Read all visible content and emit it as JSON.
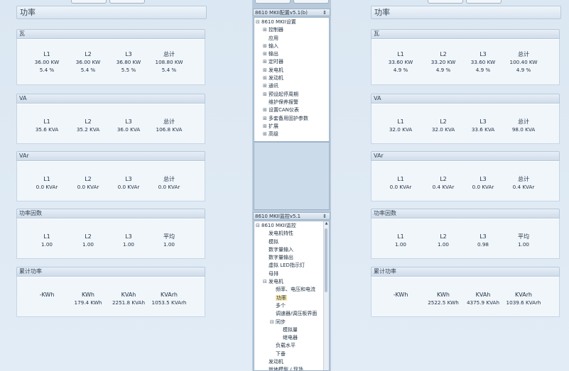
{
  "left": {
    "title": "功率",
    "groups": [
      {
        "name": "瓦",
        "cells": [
          {
            "label": "L1",
            "lines": [
              "36.00 KW",
              "5.4 %"
            ]
          },
          {
            "label": "L2",
            "lines": [
              "36.00 KW",
              "5.4 %"
            ]
          },
          {
            "label": "L3",
            "lines": [
              "36.80 KW",
              "5.5 %"
            ]
          },
          {
            "label": "总计",
            "lines": [
              "108.80 KW",
              "5.4 %"
            ]
          }
        ]
      },
      {
        "name": "VA",
        "cells": [
          {
            "label": "L1",
            "lines": [
              "35.6 KVA"
            ]
          },
          {
            "label": "L2",
            "lines": [
              "35.2 KVA"
            ]
          },
          {
            "label": "L3",
            "lines": [
              "36.0 KVA"
            ]
          },
          {
            "label": "总计",
            "lines": [
              "106.8 KVA"
            ]
          }
        ]
      },
      {
        "name": "VAr",
        "cells": [
          {
            "label": "L1",
            "lines": [
              "0.0 KVAr"
            ]
          },
          {
            "label": "L2",
            "lines": [
              "0.0 KVAr"
            ]
          },
          {
            "label": "L3",
            "lines": [
              "0.0 KVAr"
            ]
          },
          {
            "label": "总计",
            "lines": [
              "0.0 KVAr"
            ]
          }
        ]
      },
      {
        "name": "功率因数",
        "cells": [
          {
            "label": "L1",
            "lines": [
              "1.00"
            ]
          },
          {
            "label": "L2",
            "lines": [
              "1.00"
            ]
          },
          {
            "label": "L3",
            "lines": [
              "1.00"
            ]
          },
          {
            "label": "平均",
            "lines": [
              "1.00"
            ]
          }
        ]
      },
      {
        "name": "累计功率",
        "cells": [
          {
            "label": "-KWh",
            "lines": [
              ""
            ]
          },
          {
            "label": "KWh",
            "lines": [
              "179.4 KWh"
            ]
          },
          {
            "label": "KVAh",
            "lines": [
              "2251.8 KVAh"
            ]
          },
          {
            "label": "KVArh",
            "lines": [
              "1053.5 KVArh"
            ]
          }
        ]
      }
    ]
  },
  "right": {
    "title": "功率",
    "groups": [
      {
        "name": "瓦",
        "cells": [
          {
            "label": "L1",
            "lines": [
              "33.60 KW",
              "4.9 %"
            ]
          },
          {
            "label": "L2",
            "lines": [
              "33.20 KW",
              "4.9 %"
            ]
          },
          {
            "label": "L3",
            "lines": [
              "33.60 KW",
              "4.9 %"
            ]
          },
          {
            "label": "总计",
            "lines": [
              "100.40 KW",
              "4.9 %"
            ]
          }
        ]
      },
      {
        "name": "VA",
        "cells": [
          {
            "label": "L1",
            "lines": [
              "32.0 KVA"
            ]
          },
          {
            "label": "L2",
            "lines": [
              "32.0 KVA"
            ]
          },
          {
            "label": "L3",
            "lines": [
              "33.6 KVA"
            ]
          },
          {
            "label": "总计",
            "lines": [
              "98.0 KVA"
            ]
          }
        ]
      },
      {
        "name": "VAr",
        "cells": [
          {
            "label": "L1",
            "lines": [
              "0.0 KVAr"
            ]
          },
          {
            "label": "L2",
            "lines": [
              "0.4 KVAr"
            ]
          },
          {
            "label": "L3",
            "lines": [
              "0.0 KVAr"
            ]
          },
          {
            "label": "总计",
            "lines": [
              "0.4 KVAr"
            ]
          }
        ]
      },
      {
        "name": "功率因数",
        "cells": [
          {
            "label": "L1",
            "lines": [
              "1.00"
            ]
          },
          {
            "label": "L2",
            "lines": [
              "1.00"
            ]
          },
          {
            "label": "L3",
            "lines": [
              "0.98"
            ]
          },
          {
            "label": "平均",
            "lines": [
              "1.00"
            ]
          }
        ]
      },
      {
        "name": "累计功率",
        "cells": [
          {
            "label": "-KWh",
            "lines": [
              ""
            ]
          },
          {
            "label": "KWh",
            "lines": [
              "2522.5 KWh"
            ]
          },
          {
            "label": "KVAh",
            "lines": [
              "4375.9 KVAh"
            ]
          },
          {
            "label": "KVArh",
            "lines": [
              "1039.6 KVArh"
            ]
          }
        ]
      }
    ]
  },
  "config_tree": {
    "title": "8610 MKII配置v5.1(b)",
    "nodes": [
      {
        "text": "8610 MKII设置",
        "level": 0,
        "toggle": "⊟"
      },
      {
        "text": "控制器",
        "level": 1,
        "toggle": "⊞"
      },
      {
        "text": "应用",
        "level": 1,
        "toggle": ""
      },
      {
        "text": "输入",
        "level": 1,
        "toggle": "⊞"
      },
      {
        "text": "输出",
        "level": 1,
        "toggle": "⊞"
      },
      {
        "text": "定时器",
        "level": 1,
        "toggle": "⊞"
      },
      {
        "text": "发电机",
        "level": 1,
        "toggle": "⊞"
      },
      {
        "text": "发动机",
        "level": 1,
        "toggle": "⊞"
      },
      {
        "text": "通讯",
        "level": 1,
        "toggle": "⊞"
      },
      {
        "text": "预设起停周期",
        "level": 1,
        "toggle": "⊞"
      },
      {
        "text": "维护保养报警",
        "level": 1,
        "toggle": ""
      },
      {
        "text": "设置CAN仪表",
        "level": 1,
        "toggle": "⊞"
      },
      {
        "text": "多套备用固护参数",
        "level": 1,
        "toggle": "⊞"
      },
      {
        "text": "扩展",
        "level": 1,
        "toggle": "⊞"
      },
      {
        "text": "高级",
        "level": 1,
        "toggle": "⊞"
      }
    ]
  },
  "monitor_tree": {
    "title": "8610 MKII监控v5.1",
    "nodes": [
      {
        "text": "8610 MKII监控",
        "level": 0,
        "toggle": "⊟"
      },
      {
        "text": "发电机特性",
        "level": 1,
        "toggle": ""
      },
      {
        "text": "模拟",
        "level": 1,
        "toggle": ""
      },
      {
        "text": "数字量输入",
        "level": 1,
        "toggle": ""
      },
      {
        "text": "数字量输出",
        "level": 1,
        "toggle": ""
      },
      {
        "text": "虚拟 LED指示灯",
        "level": 1,
        "toggle": ""
      },
      {
        "text": "母排",
        "level": 1,
        "toggle": ""
      },
      {
        "text": "发电机",
        "level": 1,
        "toggle": "⊟"
      },
      {
        "text": "频率、电压和电流",
        "level": 2,
        "toggle": ""
      },
      {
        "text": "功率",
        "level": 2,
        "toggle": "",
        "selected": true
      },
      {
        "text": "多个",
        "level": 2,
        "toggle": ""
      },
      {
        "text": "调速器/调压板界面",
        "level": 2,
        "toggle": ""
      },
      {
        "text": "同步",
        "level": 2,
        "toggle": "⊟"
      },
      {
        "text": "模拟量",
        "level": 3,
        "toggle": ""
      },
      {
        "text": "继电器",
        "level": 3,
        "toggle": ""
      },
      {
        "text": "负载水平",
        "level": 2,
        "toggle": ""
      },
      {
        "text": "下垂",
        "level": 2,
        "toggle": ""
      },
      {
        "text": "发动机",
        "level": 1,
        "toggle": ""
      },
      {
        "text": "就地模型 / 现场",
        "level": 1,
        "toggle": ""
      }
    ]
  }
}
